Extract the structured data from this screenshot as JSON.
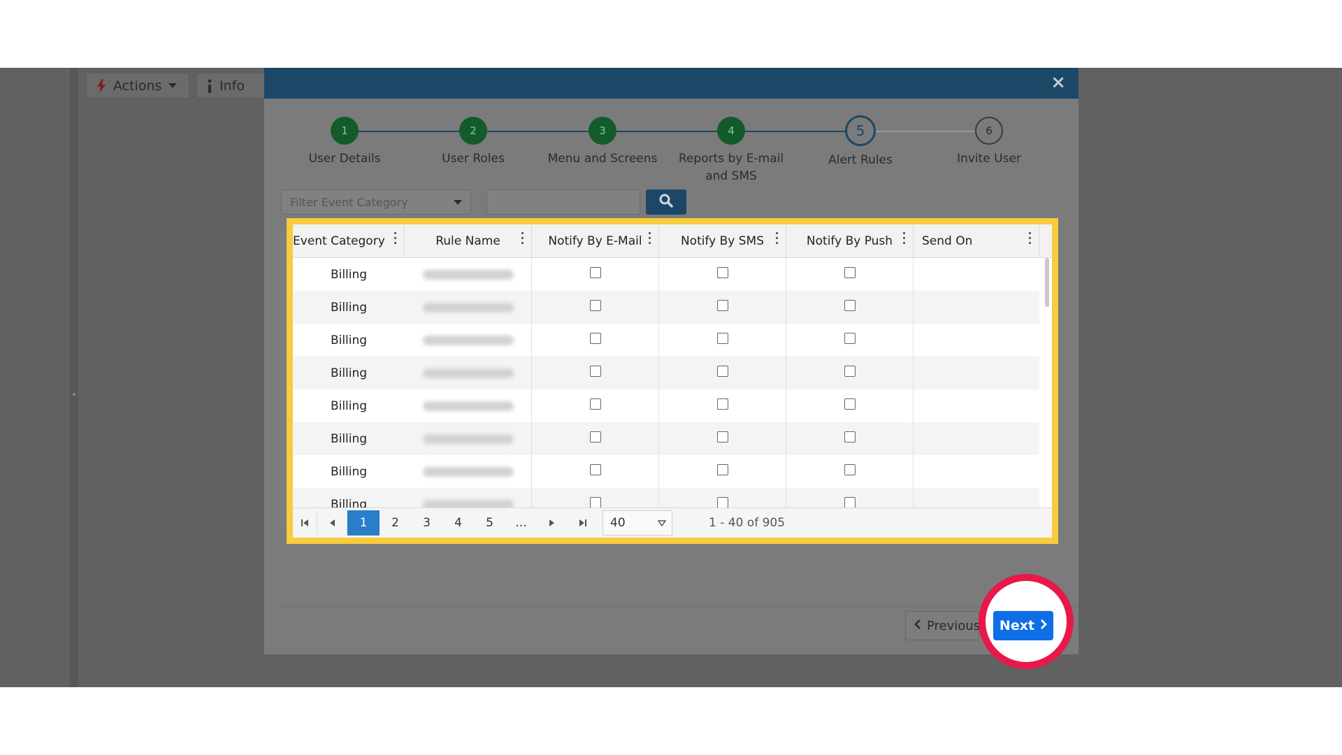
{
  "background": {
    "actions_label": "Actions",
    "info_label": "Info"
  },
  "wizard": {
    "steps": [
      {
        "num": "1",
        "label": "User Details",
        "state": "done"
      },
      {
        "num": "2",
        "label": "User Roles",
        "state": "done"
      },
      {
        "num": "3",
        "label": "Menu and Screens",
        "state": "done"
      },
      {
        "num": "4",
        "label": "Reports by E-mail and SMS",
        "state": "done"
      },
      {
        "num": "5",
        "label": "Alert Rules",
        "state": "active"
      },
      {
        "num": "6",
        "label": "Invite User",
        "state": "todo"
      }
    ]
  },
  "filter": {
    "category_placeholder": "Filter Event Category",
    "search_value": ""
  },
  "grid": {
    "columns": [
      "Event Category",
      "Rule Name",
      "Notify By E-Mail",
      "Notify By SMS",
      "Notify By Push",
      "Send On"
    ],
    "rows": [
      {
        "category": "Billing",
        "email": false,
        "sms": false,
        "push": false,
        "send_on": ""
      },
      {
        "category": "Billing",
        "email": false,
        "sms": false,
        "push": false,
        "send_on": ""
      },
      {
        "category": "Billing",
        "email": false,
        "sms": false,
        "push": false,
        "send_on": ""
      },
      {
        "category": "Billing",
        "email": false,
        "sms": false,
        "push": false,
        "send_on": ""
      },
      {
        "category": "Billing",
        "email": false,
        "sms": false,
        "push": false,
        "send_on": ""
      },
      {
        "category": "Billing",
        "email": false,
        "sms": false,
        "push": false,
        "send_on": ""
      },
      {
        "category": "Billing",
        "email": false,
        "sms": false,
        "push": false,
        "send_on": ""
      },
      {
        "category": "Billing",
        "email": false,
        "sms": false,
        "push": false,
        "send_on": ""
      }
    ]
  },
  "pager": {
    "pages": [
      "1",
      "2",
      "3",
      "4",
      "5",
      "..."
    ],
    "current_page": "1",
    "page_size": "40",
    "info": "1 - 40 of 905"
  },
  "buttons": {
    "previous_label": "Previous",
    "next_label": "Next"
  },
  "colors": {
    "highlight_box": "#f7cc3e",
    "highlight_ring": "#e8184a",
    "primary": "#0d6ee6",
    "header": "#1c4766",
    "step_done": "#145b2b"
  }
}
